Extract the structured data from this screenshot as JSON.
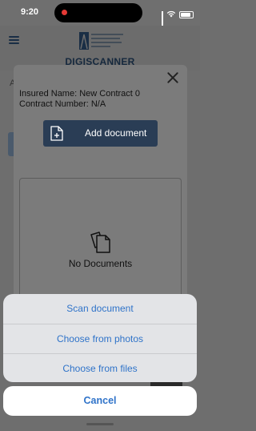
{
  "status_bar": {
    "time": "9:20"
  },
  "app": {
    "title": "DIGISCANNER",
    "bg_label_fragment": "A"
  },
  "modal": {
    "insured_name": "Insured Name: New Contract 0",
    "contract_number": "Contract Number: N/A",
    "add_document_label": "Add document",
    "empty_label": "No Documents"
  },
  "action_sheet": {
    "options": [
      "Scan document",
      "Choose from photos",
      "Choose from files"
    ],
    "cancel_label": "Cancel"
  },
  "colors": {
    "accent": "#2f73c9",
    "primary_button": "#2a3d55",
    "recording_dot": "#e53935"
  }
}
